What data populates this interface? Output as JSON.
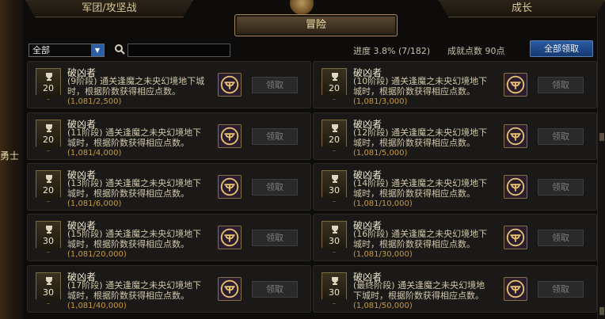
{
  "tabs": {
    "left": "军团/攻坚战",
    "right": "成长",
    "active": "冒险"
  },
  "side_text": "勇士",
  "filter": {
    "selected": "全部"
  },
  "search": {
    "placeholder": ""
  },
  "stats": {
    "progress": "进度  3.8% (7/182)",
    "points": "成就点数 90点"
  },
  "claim_all_label": "全部领取",
  "cards": [
    {
      "title": "破凶者",
      "desc": "(9阶段) 通关逢魔之未央幻境地下城时，根据阶数获得相应点数。",
      "progress": "(1,081/2,500)",
      "points": "20",
      "claim": "领取"
    },
    {
      "title": "破凶者",
      "desc": "(10阶段) 通关逢魔之未央幻境地下城时，根据阶数获得相应点数。",
      "progress": "(1,081/3,000)",
      "points": "20",
      "claim": "领取"
    },
    {
      "title": "破凶者",
      "desc": "(11阶段) 通关逢魔之未央幻境地下城时，根据阶数获得相应点数。",
      "progress": "(1,081/4,000)",
      "points": "20",
      "claim": "领取"
    },
    {
      "title": "破凶者",
      "desc": "(12阶段) 通关逢魔之未央幻境地下城时，根据阶数获得相应点数。",
      "progress": "(1,081/5,000)",
      "points": "20",
      "claim": "领取"
    },
    {
      "title": "破凶者",
      "desc": "(13阶段) 通关逢魔之未央幻境地下城时，根据阶数获得相应点数。",
      "progress": "(1,081/6,000)",
      "points": "20",
      "claim": "领取"
    },
    {
      "title": "破凶者",
      "desc": "(14阶段) 通关逢魔之未央幻境地下城时，根据阶数获得相应点数。",
      "progress": "(1,081/10,000)",
      "points": "30",
      "claim": "领取"
    },
    {
      "title": "破凶者",
      "desc": "(15阶段) 通关逢魔之未央幻境地下城时，根据阶数获得相应点数。",
      "progress": "(1,081/20,000)",
      "points": "30",
      "claim": "领取"
    },
    {
      "title": "破凶者",
      "desc": "(16阶段) 通关逢魔之未央幻境地下城时，根据阶数获得相应点数。",
      "progress": "(1,081/30,000)",
      "points": "30",
      "claim": "领取"
    },
    {
      "title": "破凶者",
      "desc": "(17阶段) 通关逢魔之未央幻境地下城时，根据阶数获得相应点数。",
      "progress": "(1,081/40,000)",
      "points": "30",
      "claim": "领取"
    },
    {
      "title": "破凶者",
      "desc": "(最终阶段) 通关逢魔之未央幻境地下城时，根据阶数获得相应点数。",
      "progress": "(1,081/50,000)",
      "points": "30",
      "claim": "领取"
    }
  ]
}
